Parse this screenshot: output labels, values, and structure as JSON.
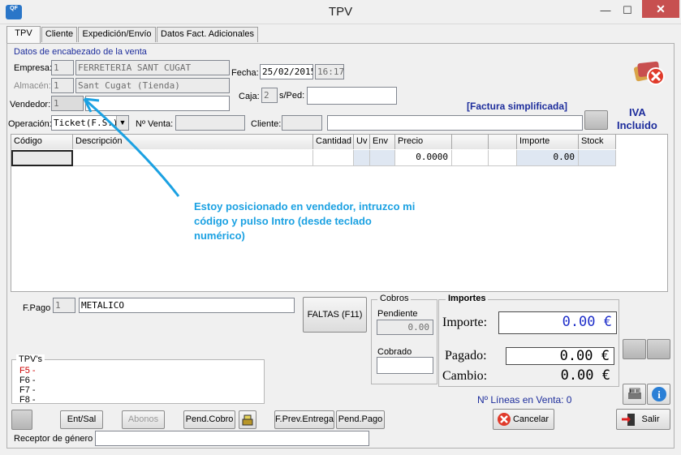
{
  "window": {
    "app_icon_text": "QF",
    "title": "TPV",
    "minimize": "—",
    "maximize": "☐",
    "close": "✕"
  },
  "tabs": [
    "TPV",
    "Cliente",
    "Expedición/Envío",
    "Datos Fact. Adicionales"
  ],
  "header": {
    "section_title": "Datos de encabezado de la venta",
    "empresa_label": "Empresa:",
    "empresa_code": "1",
    "empresa_name": "FERRETERIA SANT CUGAT",
    "almacen_label": "Almacén:",
    "almacen_code": "1",
    "almacen_name": "Sant Cugat (Tienda)",
    "vendedor_label": "Vendedor:",
    "vendedor_code": "1",
    "vendedor_name": "",
    "fecha_label": "Fecha:",
    "fecha": "25/02/2015",
    "hora": "16:17",
    "caja_label": "Caja:",
    "caja": "2",
    "sped_label": "s/Ped:",
    "sped": "",
    "operacion_label": "Operación:",
    "operacion": "Ticket(F.S.)",
    "nventa_label": "Nº Venta:",
    "nventa": "",
    "cliente_label": "Cliente:",
    "cliente_code": "",
    "cliente_name": "",
    "factura_simplificada": "[Factura simplificada]",
    "iva_line1": "IVA",
    "iva_line2": "Incluido"
  },
  "grid": {
    "columns": [
      "Código",
      "Descripción",
      "Cantidad",
      "Uv",
      "Env",
      "Precio",
      "",
      "",
      "Importe",
      "Stock"
    ],
    "row": {
      "precio": "0.0000",
      "importe": "0.00"
    }
  },
  "annotation": {
    "text_line1": "Estoy posicionado en vendedor, intruzco mi",
    "text_line2": "código y pulso Intro (desde teclado",
    "text_line3": "numérico)",
    "color": "#1ba1e2"
  },
  "payment": {
    "fpago_label": "F.Pago",
    "fpago_code": "1",
    "fpago_name": "METALICO",
    "faltas_button": "FALTAS (F11)"
  },
  "cobros": {
    "title": "Cobros",
    "pendiente_label": "Pendiente",
    "pendiente": "0.00",
    "cobrado_label": "Cobrado",
    "cobrado": ""
  },
  "importes": {
    "title": "Importes",
    "importe_label": "Importe:",
    "importe": "0.00 €",
    "pagado_label": "Pagado:",
    "pagado": "0.00 €",
    "cambio_label": "Cambio:",
    "cambio": "0.00 €",
    "lineas": "Nº Líneas en Venta: 0"
  },
  "tpvs": {
    "title": "TPV's",
    "f5": "F5 -",
    "f6": "F6 -",
    "f7": "F7 -",
    "f8": "F8 -"
  },
  "buttons": {
    "ent_sal": "Ent/Sal",
    "abonos": "Abonos",
    "pend_cobro": "Pend.Cobro",
    "prev_entrega": "F.Prev.Entrega",
    "pend_pago": "Pend.Pago",
    "cancelar": "Cancelar",
    "salir": "Salir"
  },
  "receptor": {
    "label": "Receptor de género",
    "value": ""
  }
}
